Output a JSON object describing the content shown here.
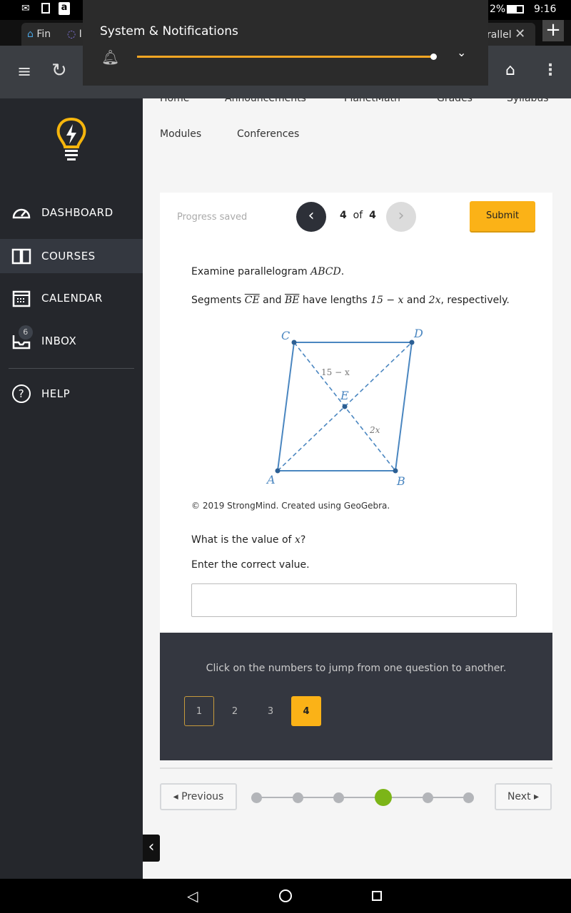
{
  "status_bar": {
    "battery": "2%",
    "time": "9:16"
  },
  "browser": {
    "tabs": [
      {
        "label": "Fin"
      },
      {
        "label": "I"
      },
      {
        "label": "rallel"
      }
    ],
    "new_tab": "+"
  },
  "notification": {
    "title": "System & Notifications",
    "volume_level": 1.0,
    "accent": "#f5a623"
  },
  "course_nav": {
    "top_row": [
      "Home",
      "Announcements",
      "PlanetMath",
      "Grades",
      "Syllabus"
    ],
    "second_row": [
      "Modules",
      "Conferences"
    ]
  },
  "sidebar": {
    "items": [
      {
        "label": "DASHBOARD",
        "icon": "speedometer-icon"
      },
      {
        "label": "COURSES",
        "icon": "book-icon",
        "active": true
      },
      {
        "label": "CALENDAR",
        "icon": "calendar-icon"
      },
      {
        "label": "INBOX",
        "icon": "inbox-icon",
        "badge": "6"
      },
      {
        "label": "HELP",
        "icon": "help-icon"
      }
    ]
  },
  "quiz": {
    "progress_status": "Progress saved",
    "current": "4",
    "of_label": "of",
    "total": "4",
    "submit_label": "Submit",
    "prompt1_text": "Examine parallelogram ",
    "prompt1_math": "ABCD",
    "prompt1_end": ".",
    "prompt2": {
      "a": "Segments ",
      "seg1": "CE",
      "b": " and ",
      "seg2": "BE",
      "c": " have lengths ",
      "len1": "15 − x",
      "d": " and ",
      "len2": "2x",
      "e": ", respectively."
    },
    "diagram": {
      "labels": {
        "A": "A",
        "B": "B",
        "C": "C",
        "D": "D",
        "E": "E"
      },
      "ce_label": "15 − x",
      "be_label": "2x",
      "color": "#4a86c0"
    },
    "credit": "© 2019 StrongMind. Created using GeoGebra.",
    "question_text": "What is the value of ",
    "question_math": "x",
    "question_end": "?",
    "instruction": "Enter the correct value.",
    "answer_value": ""
  },
  "jump": {
    "hint": "Click on the numbers to jump from one question to another.",
    "numbers": [
      "1",
      "2",
      "3",
      "4"
    ],
    "current": "4"
  },
  "pager": {
    "previous_label": "◂ Previous",
    "next_label": "Next ▸",
    "steps": 6,
    "current_step": 4,
    "active_color": "#7cb518"
  }
}
